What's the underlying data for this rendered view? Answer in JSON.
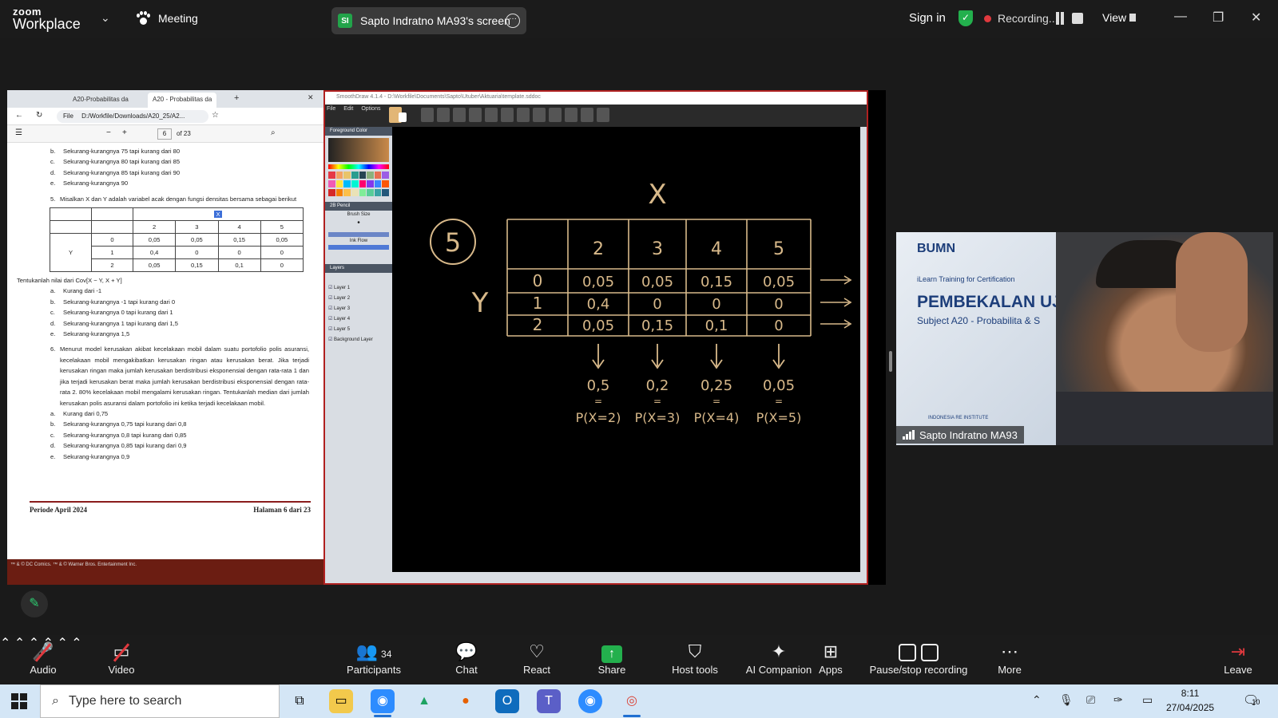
{
  "topbar": {
    "logo_line1": "zoom",
    "logo_line2": "Workplace",
    "meeting_label": "Meeting",
    "share_badge": "SI",
    "share_label": "Sapto Indratno MA93's screen",
    "signin": "Sign in",
    "recording_label": "Recording...",
    "view_label": "View"
  },
  "pdf": {
    "tab1": "A20-Probabilitas da",
    "tab2": "A20 - Probabilitas da",
    "file_label": "File",
    "url": "D:/Workfile/Downloads/A20_25/A2...",
    "page_current": "6",
    "page_total": "of 23",
    "top_options": [
      {
        "k": "b.",
        "t": "Sekurang-kurangnya 75 tapi kurang dari 80"
      },
      {
        "k": "c.",
        "t": "Sekurang-kurangnya 80 tapi kurang dari 85"
      },
      {
        "k": "d.",
        "t": "Sekurang-kurangnya 85 tapi kurang dari 90"
      },
      {
        "k": "e.",
        "t": "Sekurang-kurangnya 90"
      }
    ],
    "q5_num": "5.",
    "q5_text": "Misalkan X dan Y adalah variabel acak dengan fungsi densitas bersama sebagai berikut",
    "table": {
      "x_label": "X",
      "x_values": [
        "2",
        "3",
        "4",
        "5"
      ],
      "y_label": "Y",
      "rows": [
        {
          "y": "0",
          "v": [
            "0,05",
            "0,05",
            "0,15",
            "0,05"
          ]
        },
        {
          "y": "1",
          "v": [
            "0,4",
            "0",
            "0",
            "0"
          ]
        },
        {
          "y": "2",
          "v": [
            "0,05",
            "0,15",
            "0,1",
            "0"
          ]
        }
      ]
    },
    "q5_ask": "Tentukanlah nilai dari Cov[X − Y, X + Y]",
    "q5_options": [
      {
        "k": "a.",
        "t": "Kurang dari -1"
      },
      {
        "k": "b.",
        "t": "Sekurang-kurangnya -1 tapi kurang dari 0"
      },
      {
        "k": "c.",
        "t": "Sekurang-kurangnya 0 tapi kurang dari 1"
      },
      {
        "k": "d.",
        "t": "Sekurang-kurangnya 1 tapi kurang dari 1,5"
      },
      {
        "k": "e.",
        "t": "Sekurang-kurangnya 1,5"
      }
    ],
    "q6_num": "6.",
    "q6_text": "Menurut model kerusakan akibat kecelakaan mobil dalam suatu portofolio polis asuransi, kecelakaan mobil mengakibatkan kerusakan ringan atau kerusakan berat. Jika terjadi kerusakan ringan maka jumlah kerusakan berdistribusi eksponensial dengan rata-rata 1 dan jika terjadi kerusakan berat maka jumlah kerusakan berdistribusi eksponensial dengan rata-rata 2. 80% kecelakaan mobil mengalami kerusakan ringan. Tentukanlah median dari jumlah kerusakan polis asuransi dalam portofolio ini ketika terjadi kecelakaan mobil.",
    "q6_options": [
      {
        "k": "a.",
        "t": "Kurang dari 0,75"
      },
      {
        "k": "b.",
        "t": "Sekurang-kurangnya 0,75 tapi kurang dari 0,8"
      },
      {
        "k": "c.",
        "t": "Sekurang-kurangnya 0,8 tapi kurang dari 0,85"
      },
      {
        "k": "d.",
        "t": "Sekurang-kurangnya 0,85 tapi kurang dari 0,9"
      },
      {
        "k": "e.",
        "t": "Sekurang-kurangnya 0,9"
      }
    ],
    "footer_left": "Periode April 2024",
    "footer_right": "Halaman 6 dari 23",
    "bottom_text": "™ & © DC Comics. ™ & © Warner Bros. Entertainment Inc."
  },
  "smoothdraw": {
    "title": "SmoothDraw 4.1.4 - D:\\Workfile\\Documents\\Sapto\\Utuber\\Aktuaria\\template.sddoc",
    "menu": [
      "File",
      "Edit",
      "Options"
    ],
    "panel_foreground": "Foreground Color",
    "panel_brush": "2B Pencil",
    "brush_size_label": "Brush Size",
    "ink_flow_label": "Ink Flow",
    "panel_layers": "Layers",
    "layers": [
      "Layer 1",
      "Layer 2",
      "Layer 3",
      "Layer 4",
      "Layer 5",
      "Background Layer"
    ],
    "accent_color": "#d8b98a"
  },
  "whiteboard": {
    "question_number": "5",
    "x_mark": "X",
    "y_mark": "Y",
    "x_values": [
      "2",
      "3",
      "4",
      "5"
    ],
    "rows": [
      {
        "y": "0",
        "v": [
          "0,05",
          "0,05",
          "0,15",
          "0,05"
        ]
      },
      {
        "y": "1",
        "v": [
          "0,4",
          "0",
          "0",
          "0"
        ]
      },
      {
        "y": "2",
        "v": [
          "0,05",
          "0,15",
          "0,1",
          "0"
        ]
      }
    ],
    "marginals": [
      "0,5",
      "0,2",
      "0,25",
      "0,05"
    ],
    "prob_labels": [
      "P(X=2)",
      "P(X=3)",
      "P(X=4)",
      "P(X=5)"
    ]
  },
  "video": {
    "slide_logo": "BUMN",
    "slide_sub1": "iLearn Training for Certification",
    "slide_title": "PEMBEKALAN UJI",
    "slide_subject": "Subject A20 - Probabilita & S",
    "slide_institute": "INDONESIA RE INSTITUTE",
    "participant_name": "Sapto Indratno MA93"
  },
  "controls": {
    "audio": "Audio",
    "video": "Video",
    "participants": "Participants",
    "participants_count": "34",
    "chat": "Chat",
    "react": "React",
    "share": "Share",
    "host_tools": "Host tools",
    "ai_companion": "AI Companion",
    "apps": "Apps",
    "pause_stop": "Pause/stop recording",
    "more": "More",
    "leave": "Leave"
  },
  "taskbar": {
    "search_placeholder": "Type here to search",
    "time": "8:11",
    "date": "27/04/2025",
    "notif_count": "10"
  },
  "colors": {
    "recording_red": "#e0393e",
    "share_green": "#23b04d",
    "chalk": "#d8b98a"
  }
}
